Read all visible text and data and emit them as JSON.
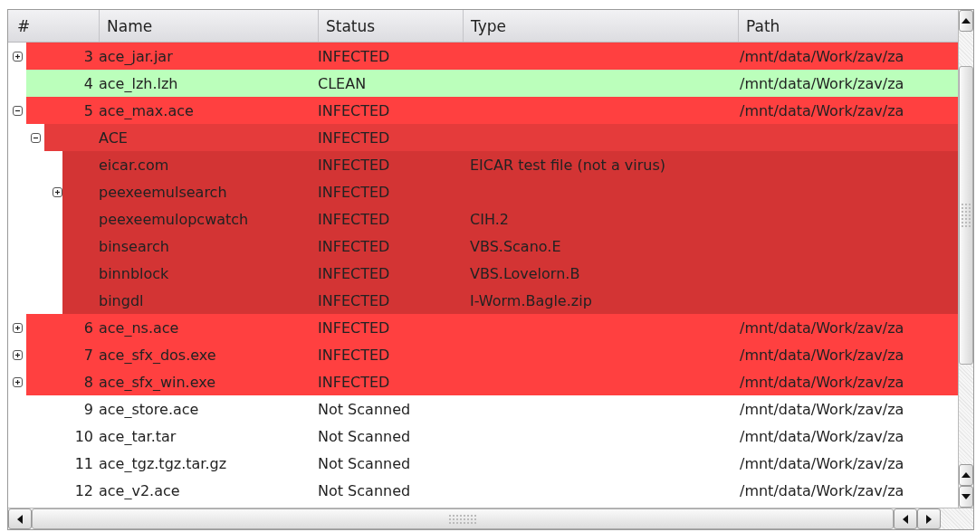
{
  "table": {
    "columns": [
      "#",
      "Name",
      "Status",
      "Type",
      "Path"
    ],
    "rows": [
      {
        "number": "3",
        "name": "ace_jar.jar",
        "status": "INFECTED",
        "path": "/mnt/data/Work/zav/za",
        "kind": "collapsed",
        "color": "#ff4040"
      },
      {
        "number": "4",
        "name": "ace_lzh.lzh",
        "status": "CLEAN",
        "path": "/mnt/data/Work/zav/za",
        "kind": "leaf",
        "color": "#bbffbb"
      },
      {
        "number": "5",
        "name": "ace_max.ace",
        "status": "INFECTED",
        "path": "/mnt/data/Work/zav/za",
        "kind": "expanded",
        "color": "#ff4040",
        "children": [
          {
            "name": "ACE",
            "status": "INFECTED",
            "kind": "expanded",
            "color": "#e53b3b",
            "children": [
              {
                "name": "eicar.com",
                "status": "INFECTED",
                "type": "EICAR test file (not a virus)",
                "kind": "leaf",
                "color": "#d33434"
              },
              {
                "name": "peexeemulsearch",
                "status": "INFECTED",
                "kind": "collapsed",
                "color": "#d33434"
              },
              {
                "name": "peexeemulopcwatch",
                "status": "INFECTED",
                "type": "CIH.2",
                "kind": "leaf",
                "color": "#d33434"
              },
              {
                "name": "binsearch",
                "status": "INFECTED",
                "type": "VBS.Scano.E",
                "kind": "leaf",
                "color": "#d33434"
              },
              {
                "name": "binnblock",
                "status": "INFECTED",
                "type": "VBS.Lovelorn.B",
                "kind": "leaf",
                "color": "#d33434"
              },
              {
                "name": "bingdl",
                "status": "INFECTED",
                "type": "I-Worm.Bagle.zip",
                "kind": "leaf",
                "color": "#d33434"
              }
            ]
          }
        ]
      },
      {
        "number": "6",
        "name": "ace_ns.ace",
        "status": "INFECTED",
        "path": "/mnt/data/Work/zav/za",
        "kind": "collapsed",
        "color": "#ff4040"
      },
      {
        "number": "7",
        "name": "ace_sfx_dos.exe",
        "status": "INFECTED",
        "path": "/mnt/data/Work/zav/za",
        "kind": "collapsed",
        "color": "#ff4040"
      },
      {
        "number": "8",
        "name": "ace_sfx_win.exe",
        "status": "INFECTED",
        "path": "/mnt/data/Work/zav/za",
        "kind": "collapsed",
        "color": "#ff4040"
      },
      {
        "number": "9",
        "name": "ace_store.ace",
        "status": "Not Scanned",
        "path": "/mnt/data/Work/zav/za",
        "kind": "leaf",
        "color": "#ffffff"
      },
      {
        "number": "10",
        "name": "ace_tar.tar",
        "status": "Not Scanned",
        "path": "/mnt/data/Work/zav/za",
        "kind": "leaf",
        "color": "#ffffff"
      },
      {
        "number": "11",
        "name": "ace_tgz.tgz.tar.gz",
        "status": "Not Scanned",
        "path": "/mnt/data/Work/zav/za",
        "kind": "leaf",
        "color": "#ffffff"
      },
      {
        "number": "12",
        "name": "ace_v2.ace",
        "status": "Not Scanned",
        "path": "/mnt/data/Work/zav/za",
        "kind": "leaf",
        "color": "#ffffff"
      }
    ]
  }
}
